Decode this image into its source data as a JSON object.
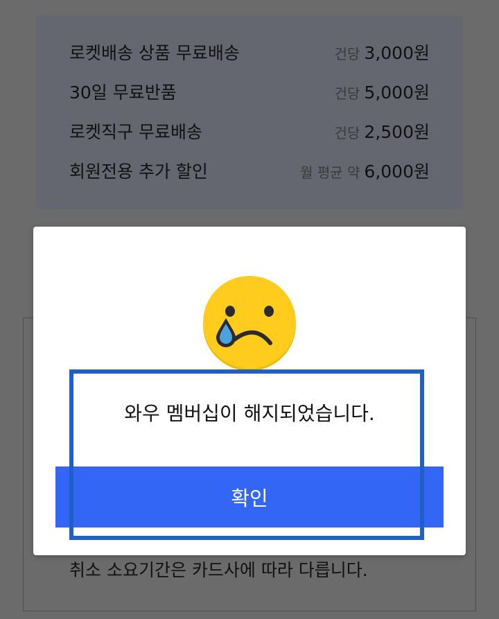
{
  "benefits": [
    {
      "title": "로켓배송 상품 무료배송",
      "prefix": "건당",
      "price": "3,000원"
    },
    {
      "title": "30일 무료반품",
      "prefix": "건당",
      "price": "5,000원"
    },
    {
      "title": "로켓직구 무료배송",
      "prefix": "건당",
      "price": "2,500원"
    },
    {
      "title": "회원전용 추가 할인",
      "prefix": "월 평균 약",
      "price": "6,000원"
    }
  ],
  "background": {
    "cancel_note": "취소 소요기간은 카드사에 따라 다릅니다."
  },
  "modal": {
    "emoji": "crying-face-icon",
    "message": "와우 멤버십이 해지되었습니다.",
    "confirm_label": "확인"
  },
  "colors": {
    "accent": "#3466f6",
    "highlight": "#1f5fc8",
    "emoji": "#ffcc1e",
    "tear": "#4aa3df"
  }
}
